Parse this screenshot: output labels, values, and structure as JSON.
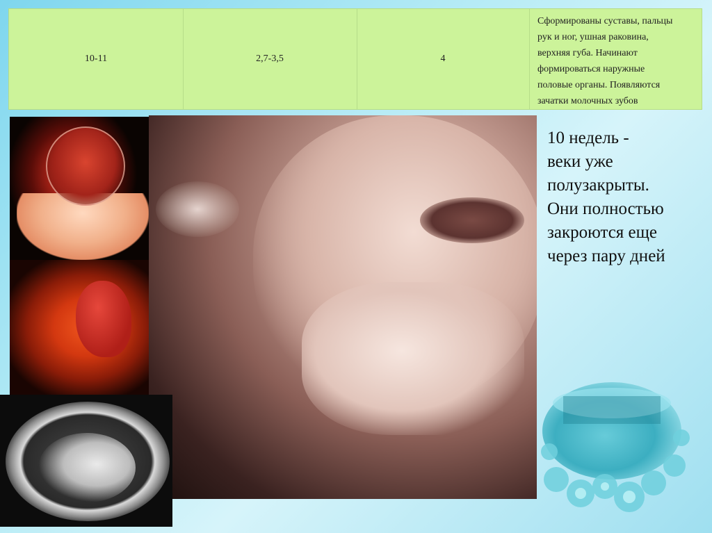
{
  "table_row": {
    "weeks": "10-11",
    "length_cm": "2,7-3,5",
    "weight_g": "4",
    "description_lines": [
      "Сформированы суставы, пальцы",
      "рук и ног, ушная раковина,",
      "верхняя губа. Начинают",
      "формироваться наружные",
      "половые органы. Появляются",
      "зачатки молочных зубов"
    ]
  },
  "caption_lines": [
    "10 недель -",
    "веки уже",
    "полузакрыты.",
    "Они полностью",
    "закроются еще",
    "через пару дней"
  ]
}
